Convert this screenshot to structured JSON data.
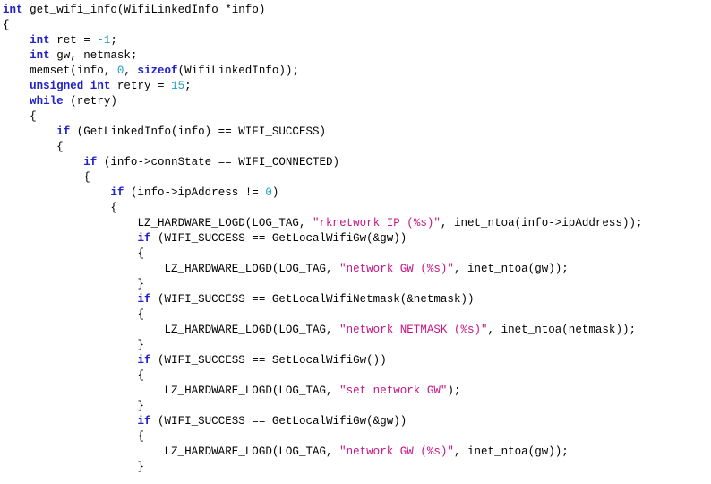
{
  "view": {
    "kind": "source-code-listing",
    "language": "C",
    "background_color": "#ffffff",
    "font_family_kind": "monospace",
    "colors": {
      "keyword": "#2222cc",
      "number": "#1f9ec4",
      "string": "#c71585",
      "plain_text": "#000000",
      "background": "#ffffff"
    }
  },
  "code": {
    "full_text": "int get_wifi_info(WifiLinkedInfo *info)\n{\n    int ret = -1;\n    int gw, netmask;\n    memset(info, 0, sizeof(WifiLinkedInfo));\n    unsigned int retry = 15;\n    while (retry)\n    {\n        if (GetLinkedInfo(info) == WIFI_SUCCESS)\n        {\n            if (info->connState == WIFI_CONNECTED)\n            {\n                if (info->ipAddress != 0)\n                {\n                    LZ_HARDWARE_LOGD(LOG_TAG, \"rknetwork IP (%s)\", inet_ntoa(info->ipAddress));\n                    if (WIFI_SUCCESS == GetLocalWifiGw(&gw))\n                    {\n                        LZ_HARDWARE_LOGD(LOG_TAG, \"network GW (%s)\", inet_ntoa(gw));\n                    }\n                    if (WIFI_SUCCESS == GetLocalWifiNetmask(&netmask))\n                    {\n                        LZ_HARDWARE_LOGD(LOG_TAG, \"network NETMASK (%s)\", inet_ntoa(netmask));\n                    }\n                    if (WIFI_SUCCESS == SetLocalWifiGw())\n                    {\n                        LZ_HARDWARE_LOGD(LOG_TAG, \"set network GW\");\n                    }\n                    if (WIFI_SUCCESS == GetLocalWifiGw(&gw))\n                    {\n                        LZ_HARDWARE_LOGD(LOG_TAG, \"network GW (%s)\", inet_ntoa(gw));\n                    }",
    "lines": [
      {
        "n": 1,
        "indent": 0,
        "tokens": [
          {
            "t": "int",
            "c": "kw"
          },
          {
            "t": " ",
            "c": "plain"
          },
          {
            "t": "get_wifi_info",
            "c": "plain"
          },
          {
            "t": "(",
            "c": "punct"
          },
          {
            "t": "WifiLinkedInfo",
            "c": "plain"
          },
          {
            "t": " *info)",
            "c": "plain"
          }
        ]
      },
      {
        "n": 2,
        "indent": 0,
        "tokens": [
          {
            "t": "{",
            "c": "punct"
          }
        ]
      },
      {
        "n": 3,
        "indent": 4,
        "tokens": [
          {
            "t": "int",
            "c": "kw"
          },
          {
            "t": " ret = ",
            "c": "plain"
          },
          {
            "t": "-1",
            "c": "num"
          },
          {
            "t": ";",
            "c": "punct"
          }
        ]
      },
      {
        "n": 4,
        "indent": 4,
        "tokens": [
          {
            "t": "int",
            "c": "kw"
          },
          {
            "t": " gw, netmask;",
            "c": "plain"
          }
        ]
      },
      {
        "n": 5,
        "indent": 4,
        "tokens": [
          {
            "t": "memset(info, ",
            "c": "plain"
          },
          {
            "t": "0",
            "c": "num"
          },
          {
            "t": ", ",
            "c": "plain"
          },
          {
            "t": "sizeof",
            "c": "kw"
          },
          {
            "t": "(WifiLinkedInfo));",
            "c": "plain"
          }
        ]
      },
      {
        "n": 6,
        "indent": 4,
        "tokens": [
          {
            "t": "unsigned",
            "c": "kw"
          },
          {
            "t": " ",
            "c": "plain"
          },
          {
            "t": "int",
            "c": "kw"
          },
          {
            "t": " retry = ",
            "c": "plain"
          },
          {
            "t": "15",
            "c": "num"
          },
          {
            "t": ";",
            "c": "punct"
          }
        ]
      },
      {
        "n": 7,
        "indent": 4,
        "tokens": [
          {
            "t": "while",
            "c": "kw"
          },
          {
            "t": " (retry)",
            "c": "plain"
          }
        ]
      },
      {
        "n": 8,
        "indent": 4,
        "tokens": [
          {
            "t": "{",
            "c": "punct"
          }
        ]
      },
      {
        "n": 9,
        "indent": 8,
        "tokens": [
          {
            "t": "if",
            "c": "kw"
          },
          {
            "t": " (GetLinkedInfo(info) == WIFI_SUCCESS)",
            "c": "plain"
          }
        ]
      },
      {
        "n": 10,
        "indent": 8,
        "tokens": [
          {
            "t": "{",
            "c": "punct"
          }
        ]
      },
      {
        "n": 11,
        "indent": 12,
        "tokens": [
          {
            "t": "if",
            "c": "kw"
          },
          {
            "t": " (info->connState == WIFI_CONNECTED)",
            "c": "plain"
          }
        ]
      },
      {
        "n": 12,
        "indent": 12,
        "tokens": [
          {
            "t": "{",
            "c": "punct"
          }
        ]
      },
      {
        "n": 13,
        "indent": 16,
        "tokens": [
          {
            "t": "if",
            "c": "kw"
          },
          {
            "t": " (info->ipAddress != ",
            "c": "plain"
          },
          {
            "t": "0",
            "c": "num"
          },
          {
            "t": ")",
            "c": "punct"
          }
        ]
      },
      {
        "n": 14,
        "indent": 16,
        "tokens": [
          {
            "t": "{",
            "c": "punct"
          }
        ]
      },
      {
        "n": 15,
        "indent": 20,
        "tokens": [
          {
            "t": "LZ_HARDWARE_LOGD(LOG_TAG, ",
            "c": "plain"
          },
          {
            "t": "\"rknetwork IP (%s)\"",
            "c": "str"
          },
          {
            "t": ", inet_ntoa(info->ipAddress));",
            "c": "plain"
          }
        ]
      },
      {
        "n": 16,
        "indent": 20,
        "tokens": [
          {
            "t": "if",
            "c": "kw"
          },
          {
            "t": " (WIFI_SUCCESS == GetLocalWifiGw(&gw))",
            "c": "plain"
          }
        ]
      },
      {
        "n": 17,
        "indent": 20,
        "tokens": [
          {
            "t": "{",
            "c": "punct"
          }
        ]
      },
      {
        "n": 18,
        "indent": 24,
        "tokens": [
          {
            "t": "LZ_HARDWARE_LOGD(LOG_TAG, ",
            "c": "plain"
          },
          {
            "t": "\"network GW (%s)\"",
            "c": "str"
          },
          {
            "t": ", inet_ntoa(gw));",
            "c": "plain"
          }
        ]
      },
      {
        "n": 19,
        "indent": 20,
        "tokens": [
          {
            "t": "}",
            "c": "punct"
          }
        ]
      },
      {
        "n": 20,
        "indent": 20,
        "tokens": [
          {
            "t": "if",
            "c": "kw"
          },
          {
            "t": " (WIFI_SUCCESS == GetLocalWifiNetmask(&netmask))",
            "c": "plain"
          }
        ]
      },
      {
        "n": 21,
        "indent": 20,
        "tokens": [
          {
            "t": "{",
            "c": "punct"
          }
        ]
      },
      {
        "n": 22,
        "indent": 24,
        "tokens": [
          {
            "t": "LZ_HARDWARE_LOGD(LOG_TAG, ",
            "c": "plain"
          },
          {
            "t": "\"network NETMASK (%s)\"",
            "c": "str"
          },
          {
            "t": ", inet_ntoa(netmask));",
            "c": "plain"
          }
        ]
      },
      {
        "n": 23,
        "indent": 20,
        "tokens": [
          {
            "t": "}",
            "c": "punct"
          }
        ]
      },
      {
        "n": 24,
        "indent": 20,
        "tokens": [
          {
            "t": "if",
            "c": "kw"
          },
          {
            "t": " (WIFI_SUCCESS == SetLocalWifiGw())",
            "c": "plain"
          }
        ]
      },
      {
        "n": 25,
        "indent": 20,
        "tokens": [
          {
            "t": "{",
            "c": "punct"
          }
        ]
      },
      {
        "n": 26,
        "indent": 24,
        "tokens": [
          {
            "t": "LZ_HARDWARE_LOGD(LOG_TAG, ",
            "c": "plain"
          },
          {
            "t": "\"set network GW\"",
            "c": "str"
          },
          {
            "t": ");",
            "c": "plain"
          }
        ]
      },
      {
        "n": 27,
        "indent": 20,
        "tokens": [
          {
            "t": "}",
            "c": "punct"
          }
        ]
      },
      {
        "n": 28,
        "indent": 20,
        "tokens": [
          {
            "t": "if",
            "c": "kw"
          },
          {
            "t": " (WIFI_SUCCESS == GetLocalWifiGw(&gw))",
            "c": "plain"
          }
        ]
      },
      {
        "n": 29,
        "indent": 20,
        "tokens": [
          {
            "t": "{",
            "c": "punct"
          }
        ]
      },
      {
        "n": 30,
        "indent": 24,
        "tokens": [
          {
            "t": "LZ_HARDWARE_LOGD(LOG_TAG, ",
            "c": "plain"
          },
          {
            "t": "\"network GW (%s)\"",
            "c": "str"
          },
          {
            "t": ", inet_ntoa(gw));",
            "c": "plain"
          }
        ]
      },
      {
        "n": 31,
        "indent": 20,
        "tokens": [
          {
            "t": "}",
            "c": "punct"
          }
        ]
      }
    ]
  }
}
